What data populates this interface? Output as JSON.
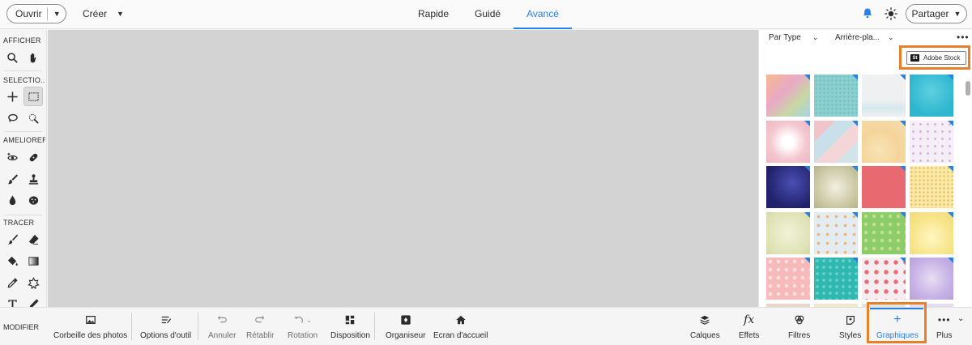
{
  "topbar": {
    "open_label": "Ouvrir",
    "create_label": "Créer",
    "tabs": [
      "Rapide",
      "Guidé",
      "Avancé"
    ],
    "active_tab": "Avancé",
    "share_label": "Partager"
  },
  "toolbox": {
    "sections": [
      "AFFICHER",
      "SELECTIO...",
      "AMELIORER",
      "TRACER",
      "MODIFIER"
    ],
    "tools": [
      "zoom-icon",
      "hand-icon",
      "move-icon",
      "rectangular-marquee-icon",
      "lasso-icon",
      "quick-selection-icon",
      "red-eye-icon",
      "spot-healing-icon",
      "smart-brush-icon",
      "clone-stamp-icon",
      "blur-icon",
      "sponge-icon",
      "brush-icon",
      "eraser-icon",
      "paint-bucket-icon",
      "gradient-icon",
      "eyedropper-icon",
      "custom-shape-icon",
      "type-icon",
      "pencil-icon"
    ]
  },
  "panel": {
    "filter_type": "Par Type",
    "filter_bg": "Arrière-pla...",
    "stock_label": "Adobe Stock",
    "stock_badge": "St"
  },
  "bottombar": {
    "left_items": [
      "Corbeille des photos",
      "Options d'outil",
      "Annuler",
      "Rétablir",
      "Rotation",
      "Disposition",
      "Organiseur",
      "Ecran d'accueil"
    ],
    "right_items": [
      "Calques",
      "Effets",
      "Filtres",
      "Styles",
      "Graphiques",
      "Plus"
    ],
    "active_item": "Graphiques"
  },
  "colors": {
    "accent": "#2680eb",
    "highlight": "#e8802a",
    "canvas": "#d3d3d3"
  }
}
